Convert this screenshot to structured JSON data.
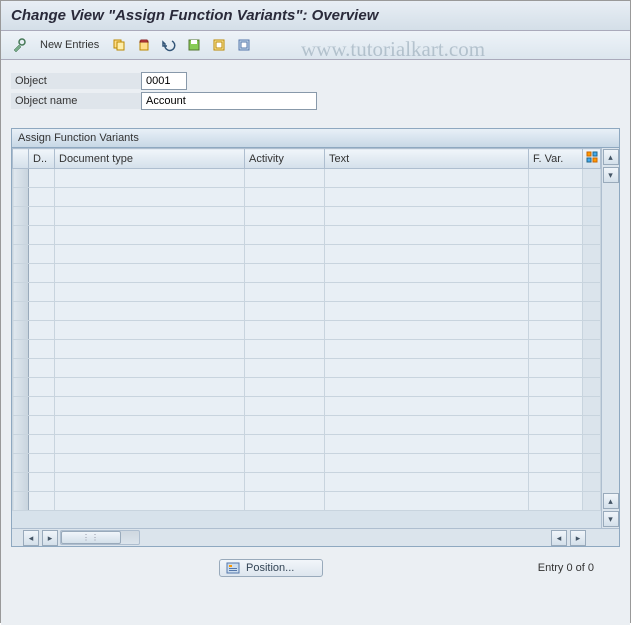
{
  "header": {
    "title": "Change View \"Assign Function Variants\": Overview"
  },
  "toolbar": {
    "new_entries": "New Entries"
  },
  "watermark": "www.tutorialkart.com",
  "fields": {
    "object_label": "Object",
    "object_value": "0001",
    "object_name_label": "Object name",
    "object_name_value": "Account"
  },
  "table": {
    "panel_title": "Assign Function Variants",
    "columns": {
      "d": "D..",
      "doc_type": "Document type",
      "activity": "Activity",
      "text": "Text",
      "fvar": "F. Var."
    },
    "row_count": 18
  },
  "footer": {
    "position_label": "Position...",
    "entry_text": "Entry 0 of 0"
  }
}
